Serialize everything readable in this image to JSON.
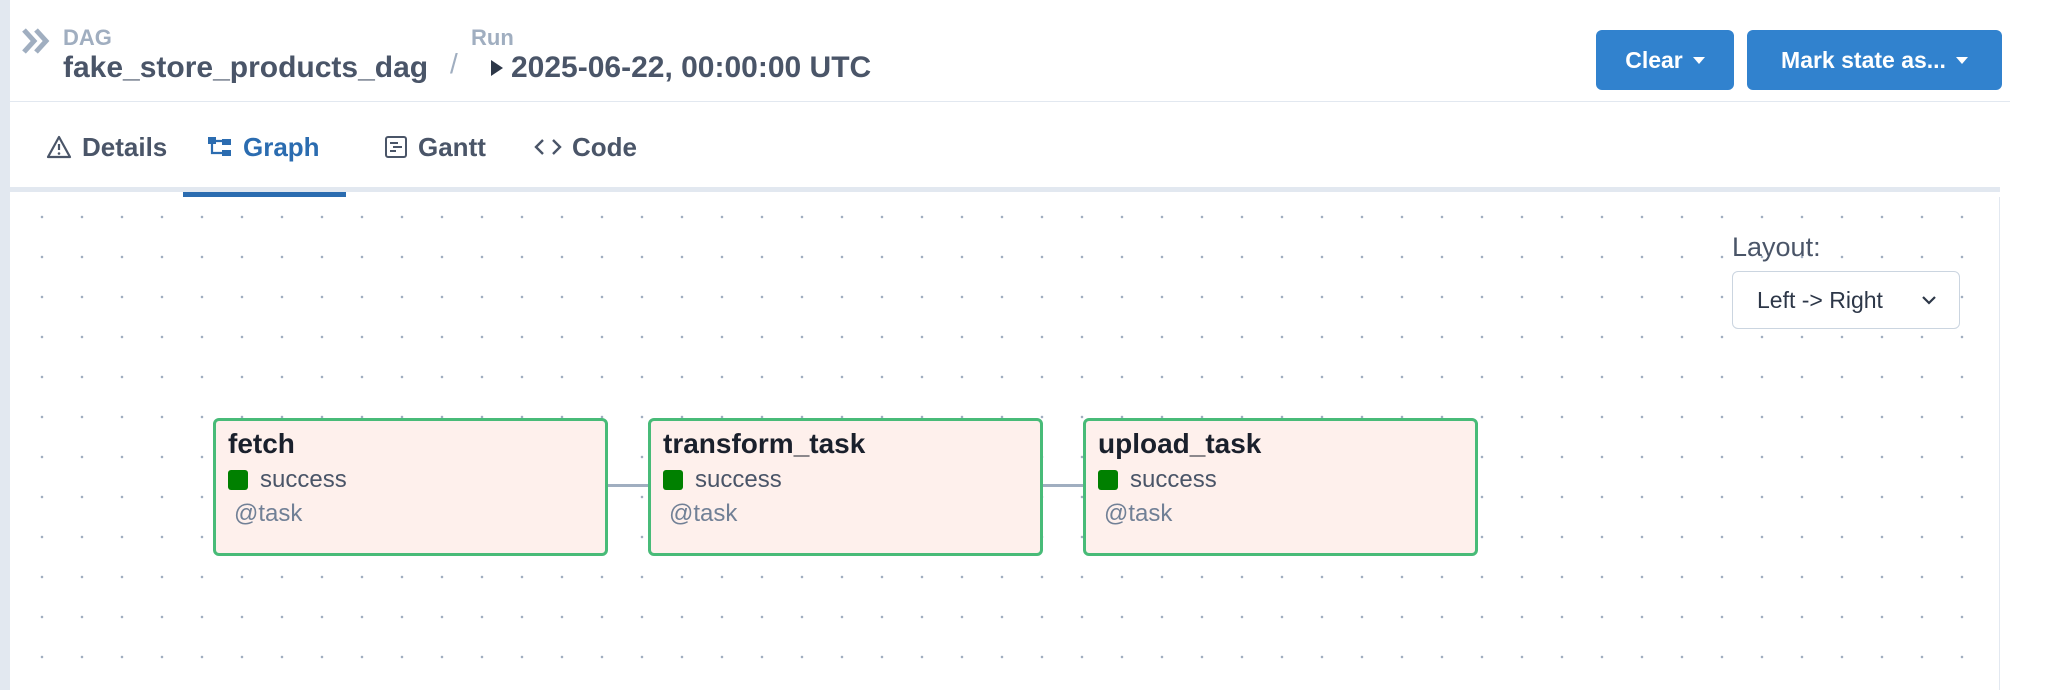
{
  "header": {
    "dag_label": "DAG",
    "dag_name": "fake_store_products_dag",
    "separator": "/",
    "run_label": "Run",
    "run_value": "2025-06-22, 00:00:00 UTC",
    "clear_label": "Clear",
    "mark_state_label": "Mark state as..."
  },
  "tabs": [
    {
      "label": "Details",
      "icon": "warning-triangle-icon",
      "active": false
    },
    {
      "label": "Graph",
      "icon": "graph-icon",
      "active": true
    },
    {
      "label": "Gantt",
      "icon": "gantt-icon",
      "active": false
    },
    {
      "label": "Code",
      "icon": "code-icon",
      "active": false
    }
  ],
  "graph": {
    "layout_label": "Layout:",
    "layout_value": "Left -> Right",
    "nodes": [
      {
        "name": "fetch",
        "state": "success",
        "type": "@task"
      },
      {
        "name": "transform_task",
        "state": "success",
        "type": "@task"
      },
      {
        "name": "upload_task",
        "state": "success",
        "type": "@task"
      }
    ]
  },
  "colors": {
    "primary": "#3182ce",
    "active_tab": "#2b6cb0",
    "node_border": "#48bb78",
    "node_bg": "#fef0ec",
    "success": "#008000"
  }
}
